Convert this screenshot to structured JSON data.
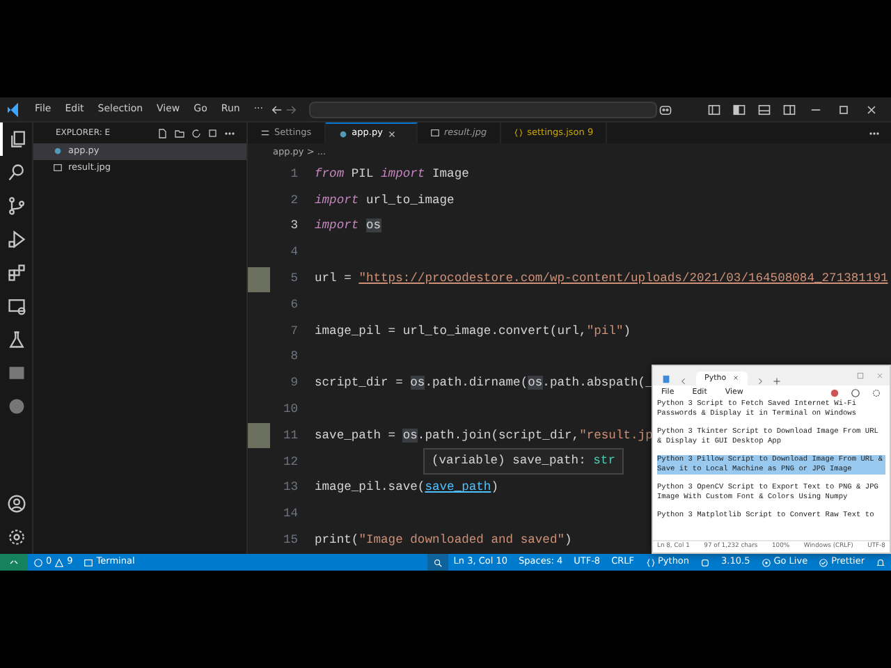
{
  "menu": [
    "File",
    "Edit",
    "Selection",
    "View",
    "Go",
    "Run",
    "···"
  ],
  "activity_bar": {
    "items": [
      {
        "kind": "files",
        "selected": true
      },
      {
        "kind": "search",
        "selected": false
      },
      {
        "kind": "git",
        "selected": false
      },
      {
        "kind": "debug",
        "selected": false
      },
      {
        "kind": "extensions",
        "selected": false
      },
      {
        "kind": "remote",
        "selected": false
      },
      {
        "kind": "flask",
        "selected": false
      },
      {
        "kind": "json",
        "selected": false
      },
      {
        "kind": "badge",
        "selected": false
      }
    ],
    "bottom": [
      {
        "kind": "account"
      },
      {
        "kind": "gear"
      }
    ]
  },
  "explorer": {
    "title": "EXPLORER: E",
    "files": [
      {
        "name": "app.py",
        "kind": "python",
        "selected": true
      },
      {
        "name": "result.jpg",
        "kind": "image",
        "selected": false
      }
    ]
  },
  "tabs": [
    {
      "label": "Settings",
      "kind": "settings",
      "selected": false,
      "preview": false
    },
    {
      "label": "app.py",
      "kind": "python",
      "selected": true,
      "preview": false
    },
    {
      "label": "result.jpg",
      "kind": "image",
      "selected": false,
      "preview": true
    },
    {
      "label": "settings.json 9",
      "kind": "json",
      "selected": false,
      "preview": false
    }
  ],
  "breadcrumb": "app.py > ...",
  "code": [
    {
      "number": "1",
      "current": false,
      "tokens": [
        {
          "text": "from",
          "kind": "kw"
        },
        {
          "text": " PIL ",
          "kind": "plain"
        },
        {
          "text": "import",
          "kind": "kw"
        },
        {
          "text": " Image",
          "kind": "plain"
        }
      ]
    },
    {
      "number": "2",
      "current": false,
      "tokens": [
        {
          "text": "import",
          "kind": "kw"
        },
        {
          "text": " url_to_image",
          "kind": "plain"
        }
      ]
    },
    {
      "number": "3",
      "current": true,
      "tokens": [
        {
          "text": "import ",
          "kind": "kw"
        },
        {
          "text": "os",
          "kind": "hl"
        }
      ]
    },
    {
      "number": "4",
      "current": false
    },
    {
      "number": "5",
      "current": false,
      "image": true,
      "tokens": [
        {
          "text": "url = ",
          "kind": "plain"
        },
        {
          "text": "\"https://procodestore.com/wp-content/uploads/2021/03/164508084_271381191",
          "kind": "url"
        }
      ]
    },
    {
      "number": "6",
      "current": false
    },
    {
      "number": "7",
      "current": false,
      "tokens": [
        {
          "text": "image_pil = url_to_image.convert(url,",
          "kind": "plain"
        },
        {
          "text": "\"pil\"",
          "kind": "str"
        },
        {
          "text": ")",
          "kind": "plain"
        }
      ]
    },
    {
      "number": "8",
      "current": false
    },
    {
      "number": "9",
      "current": false,
      "tokens": [
        {
          "text": "script_dir = ",
          "kind": "plain"
        },
        {
          "text": "os",
          "kind": "hl"
        },
        {
          "text": ".path.dirname(",
          "kind": "plain"
        },
        {
          "text": "os",
          "kind": "hl"
        },
        {
          "text": ".path.abspath(_",
          "kind": "plain"
        }
      ]
    },
    {
      "number": "10",
      "current": false
    },
    {
      "number": "11",
      "current": false,
      "image": true,
      "tokens": [
        {
          "text": "save_path = ",
          "kind": "plain"
        },
        {
          "text": "os",
          "kind": "hl"
        },
        {
          "text": ".path.join(script_dir,",
          "kind": "plain"
        },
        {
          "text": "\"result.jp",
          "kind": "str"
        }
      ]
    },
    {
      "number": "12",
      "current": false
    },
    {
      "number": "13",
      "current": false,
      "tokens": [
        {
          "text": "image_pil.save(",
          "kind": "plain"
        },
        {
          "text": "save_path",
          "kind": "link"
        },
        {
          "text": ")",
          "kind": "plain"
        }
      ]
    },
    {
      "number": "14",
      "current": false
    },
    {
      "number": "15",
      "current": false,
      "tokens": [
        {
          "text": "print(",
          "kind": "plain"
        },
        {
          "text": "\"Image downloaded and saved\"",
          "kind": "str"
        },
        {
          "text": ")",
          "kind": "plain"
        }
      ]
    }
  ],
  "hover": {
    "label": "(variable) save_path: ",
    "type": "str"
  },
  "notepad": {
    "tab": "Pytho",
    "menu": [
      "File",
      "Edit",
      "View"
    ],
    "paragraphs": [
      {
        "text": "Python 3 Script to Fetch Saved Internet Wi-Fi Passwords & Display it in Terminal on Windows",
        "selected": false
      },
      {
        "text": "Python 3 Tkinter Script to Download Image From URL & Display it GUI Desktop App",
        "selected": false
      },
      {
        "text": "Python 3 Pillow Script to Download Image From URL & Save it to Local Machine as PNG or JPG Image",
        "selected": true
      },
      {
        "text": "Python 3 OpenCV Script to Export Text to PNG & JPG Image With Custom Font & Colors Using Numpy",
        "selected": false
      },
      {
        "text": "Python 3 Matplotlib Script to Convert Raw Text to",
        "selected": false
      }
    ],
    "status": [
      "Ln 8, Col 1",
      "97 of 1,232 chars",
      "100%",
      "Windows (CRLF)",
      "UTF-8"
    ]
  },
  "status_bar": {
    "left": [
      {
        "kind": "remote"
      },
      {
        "kind": "problems",
        "errors": "0",
        "warnings": "9"
      },
      {
        "kind": "terminal",
        "text": "Terminal"
      }
    ],
    "right": [
      {
        "kind": "zoom"
      },
      {
        "kind": "text",
        "text": "Ln 3, Col 10"
      },
      {
        "kind": "text",
        "text": "Spaces: 4"
      },
      {
        "kind": "text",
        "text": "UTF-8"
      },
      {
        "kind": "text",
        "text": "CRLF"
      },
      {
        "kind": "lang",
        "text": "Python"
      },
      {
        "kind": "env"
      },
      {
        "kind": "text",
        "text": "3.10.5"
      },
      {
        "kind": "live",
        "text": "Go Live"
      },
      {
        "kind": "prettier",
        "text": "Prettier"
      },
      {
        "kind": "bell"
      }
    ]
  }
}
